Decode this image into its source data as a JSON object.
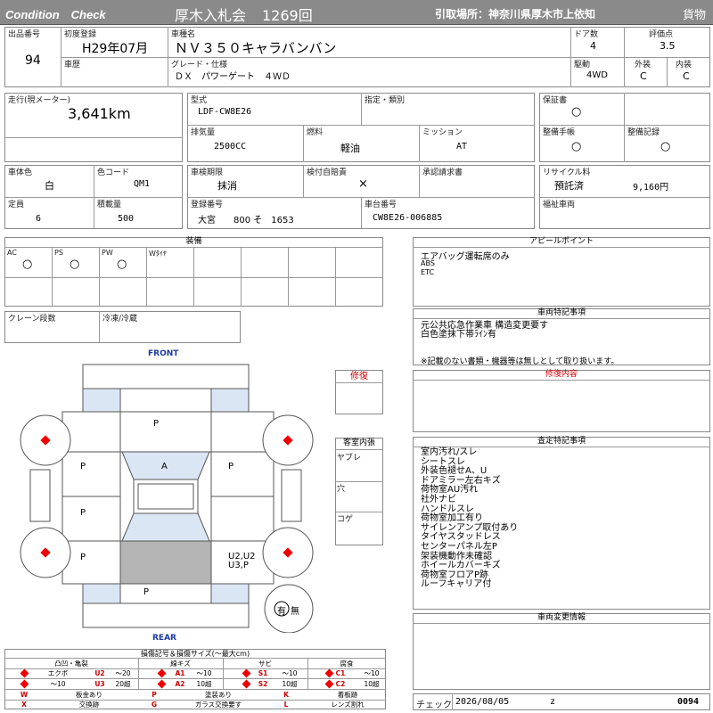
{
  "header": {
    "condition_check": "Condition　Check",
    "auction_name": "厚木入札会",
    "session": "1269回",
    "pickup": "引取場所：神奈川県厚木市上依知",
    "category": "貨物"
  },
  "vehicle": {
    "lot_label": "出品番号",
    "lot": "94",
    "first_reg_label": "初度登録",
    "first_reg": "H29年07月",
    "model_name_label": "車種名",
    "model_name": "ＮＶ３５０キャラバンバン",
    "doors_label": "ドア数",
    "doors": "4",
    "score_label": "評価点",
    "score": "3.5",
    "history_label": "車歴",
    "grade_label": "グレード・仕様",
    "grade": "ＤＸ　パワーゲート　４ＷＤ",
    "drive_label": "駆動",
    "drive": "4WD",
    "exterior_label": "外装",
    "exterior": "C",
    "interior_label": "内装",
    "interior": "C",
    "mileage_label": "走行(現メーター)",
    "mileage": "3,641km",
    "type_label": "型式",
    "type": "LDF-CW8E26",
    "designation_label": "指定・類別",
    "warranty_label": "保証書",
    "warranty": "○",
    "displacement_label": "排気量",
    "displacement": "2500CC",
    "fuel_label": "燃料",
    "fuel": "軽油",
    "transmission_label": "ミッション",
    "transmission": "AT",
    "maintenance_label": "整備手帳",
    "maintenance": "○",
    "service_record_label": "整備記録",
    "service_record": "○",
    "body_color_label": "車体色",
    "body_color": "白",
    "color_code_label": "色コード",
    "color_code": "QM1",
    "inspection_label": "車検期限",
    "inspection": "抹消",
    "insurance_label": "検付自賠責",
    "insurance": "×",
    "approval_label": "承認請求書",
    "recycle_label": "リサイクル料",
    "recycle_status": "預託済",
    "recycle_fee": "9,160円",
    "capacity_label": "定員",
    "capacity": "6",
    "load_label": "積載量",
    "load": "500",
    "reg_no_label": "登録番号",
    "reg_no": "大宮　　800 そ　1653",
    "chassis_label": "車台番号",
    "chassis": "CW8E26-006885",
    "welfare_label": "福祉車両"
  },
  "equipment": {
    "title": "装備",
    "items": [
      {
        "label": "AC",
        "mark": "○"
      },
      {
        "label": "PS",
        "mark": "○"
      },
      {
        "label": "PW",
        "mark": "○"
      },
      {
        "label": "Wﾀｲﾔ",
        "mark": ""
      }
    ],
    "crane_label": "クレーン段数",
    "freezer_label": "冷凍/冷蔵"
  },
  "appeal": {
    "title": "アピールポイント",
    "lines": [
      "エアバッグ運転席のみ",
      "ABS",
      "ETC"
    ]
  },
  "special_notes": {
    "title": "車両特記事項",
    "lines": [
      "元公共応急作業車 構造変更要す",
      "白色塗抹下帯ﾗｲﾝ有"
    ],
    "disclaimer": "※記載のない書類・機器等は無しとして取り扱います。"
  },
  "repair": {
    "label": "修復",
    "content_title": "修復内容"
  },
  "diagram": {
    "front": "FRONT",
    "rear": "REAR",
    "marks": {
      "roof": "P",
      "left_front": "P",
      "windshield": "A",
      "right_front": "P",
      "left_rear": "P",
      "left_quarter": "P",
      "right_quarter": "U2,U2",
      "right_quarter2": "U3,P",
      "rear": "P"
    },
    "tire_mark": "有",
    "tire_none": "無"
  },
  "cabin": {
    "title": "客室内張",
    "tear": "ヤブレ",
    "hole": "穴",
    "burn": "コゲ"
  },
  "assessment": {
    "title": "査定特記事項",
    "lines": [
      "室内汚れ/スレ",
      "シートスレ",
      "外装色褪せA、U",
      "ドアミラー左右キズ",
      "荷物室AU汚れ",
      "社外ナビ",
      "ハンドルスレ",
      "荷物室加工有り",
      "サイレンアンプ取付あり",
      "タイヤスタッドレス",
      "センターパネル左P",
      "架装機動作未確認",
      "ホイールカバーキズ",
      "荷物室フロアP跡",
      "ルーフキャリア付"
    ]
  },
  "change_info": {
    "title": "車両変更情報"
  },
  "legend": {
    "title": "損傷記号＆損傷サイズ(～最大cm)",
    "groups": [
      {
        "name": "凸凹・亀裂",
        "r1": [
          "エクボ",
          "U2",
          "～20"
        ],
        "r2": [
          "～10",
          "U3",
          "20超"
        ]
      },
      {
        "name": "線キズ",
        "r1": [
          "A1",
          "～10"
        ],
        "r2": [
          "A2",
          "10超"
        ]
      },
      {
        "name": "サビ",
        "r1": [
          "S1",
          "～10"
        ],
        "r2": [
          "S2",
          "10超"
        ]
      },
      {
        "name": "腐食",
        "r1": [
          "C1",
          "～10"
        ],
        "r2": [
          "C2",
          "10超"
        ]
      }
    ],
    "codes": [
      [
        "W",
        "板金あり",
        "P",
        "塗装あり",
        "K",
        "着板跡"
      ],
      [
        "X",
        "交換跡",
        "G",
        "ガラス交換要す",
        "L",
        "レンズ割れ"
      ]
    ]
  },
  "footer": {
    "check_label": "チェック",
    "date": "2026/08/05",
    "z": "z",
    "number": "0094"
  }
}
